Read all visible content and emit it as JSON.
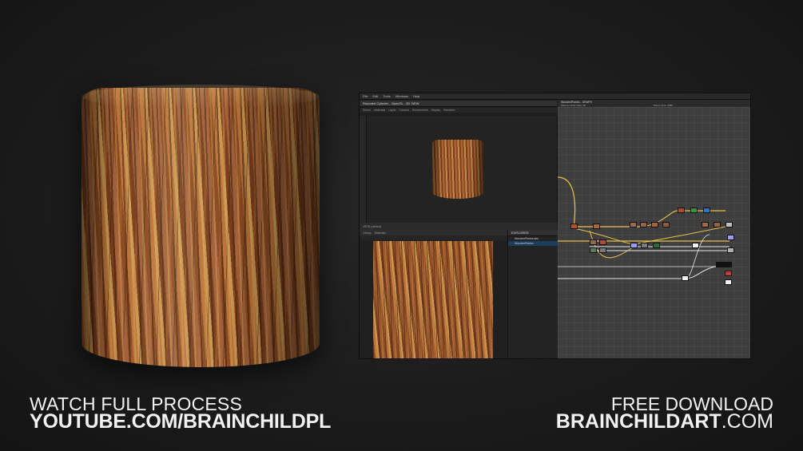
{
  "captions": {
    "left_line1": "WATCH FULL PROCESS",
    "left_line2": "YOUTUBE.COM/BRAINCHILDPL",
    "right_line1": "FREE DOWNLOAD",
    "right_line2_bold": "BRAINCHILDART",
    "right_line2_thin": ".COM"
  },
  "app": {
    "menu": [
      "File",
      "Edit",
      "Tools",
      "Windows",
      "Help"
    ],
    "viewport3d_title": "Rounded Cylinder - OpenGL - 3D VIEW",
    "viewport3d_menu": [
      "Scene",
      "Materials",
      "Lights",
      "Camera",
      "Environment",
      "Display",
      "Renderer"
    ],
    "viewport2d_tabs": [
      "Library",
      "Materials"
    ],
    "explorer_title": "EXPLORER",
    "explorer_items": [
      "WoodenPlanks.sbs",
      "WoodenPlanks"
    ],
    "graph_title": "WoodenPlanks - GRAPH",
    "graph_filter": "Filter by Node Type: All",
    "graph_parent_size": "Parent Size: 4096",
    "viewport_footer": "sRGB (default)",
    "colors": {
      "background": "#1a1a1a",
      "caption": "#f2f2f2",
      "wire_yellow": "#e8c04a",
      "wire_white": "#e6e6e6",
      "wood_mid": "#b8743a"
    }
  }
}
